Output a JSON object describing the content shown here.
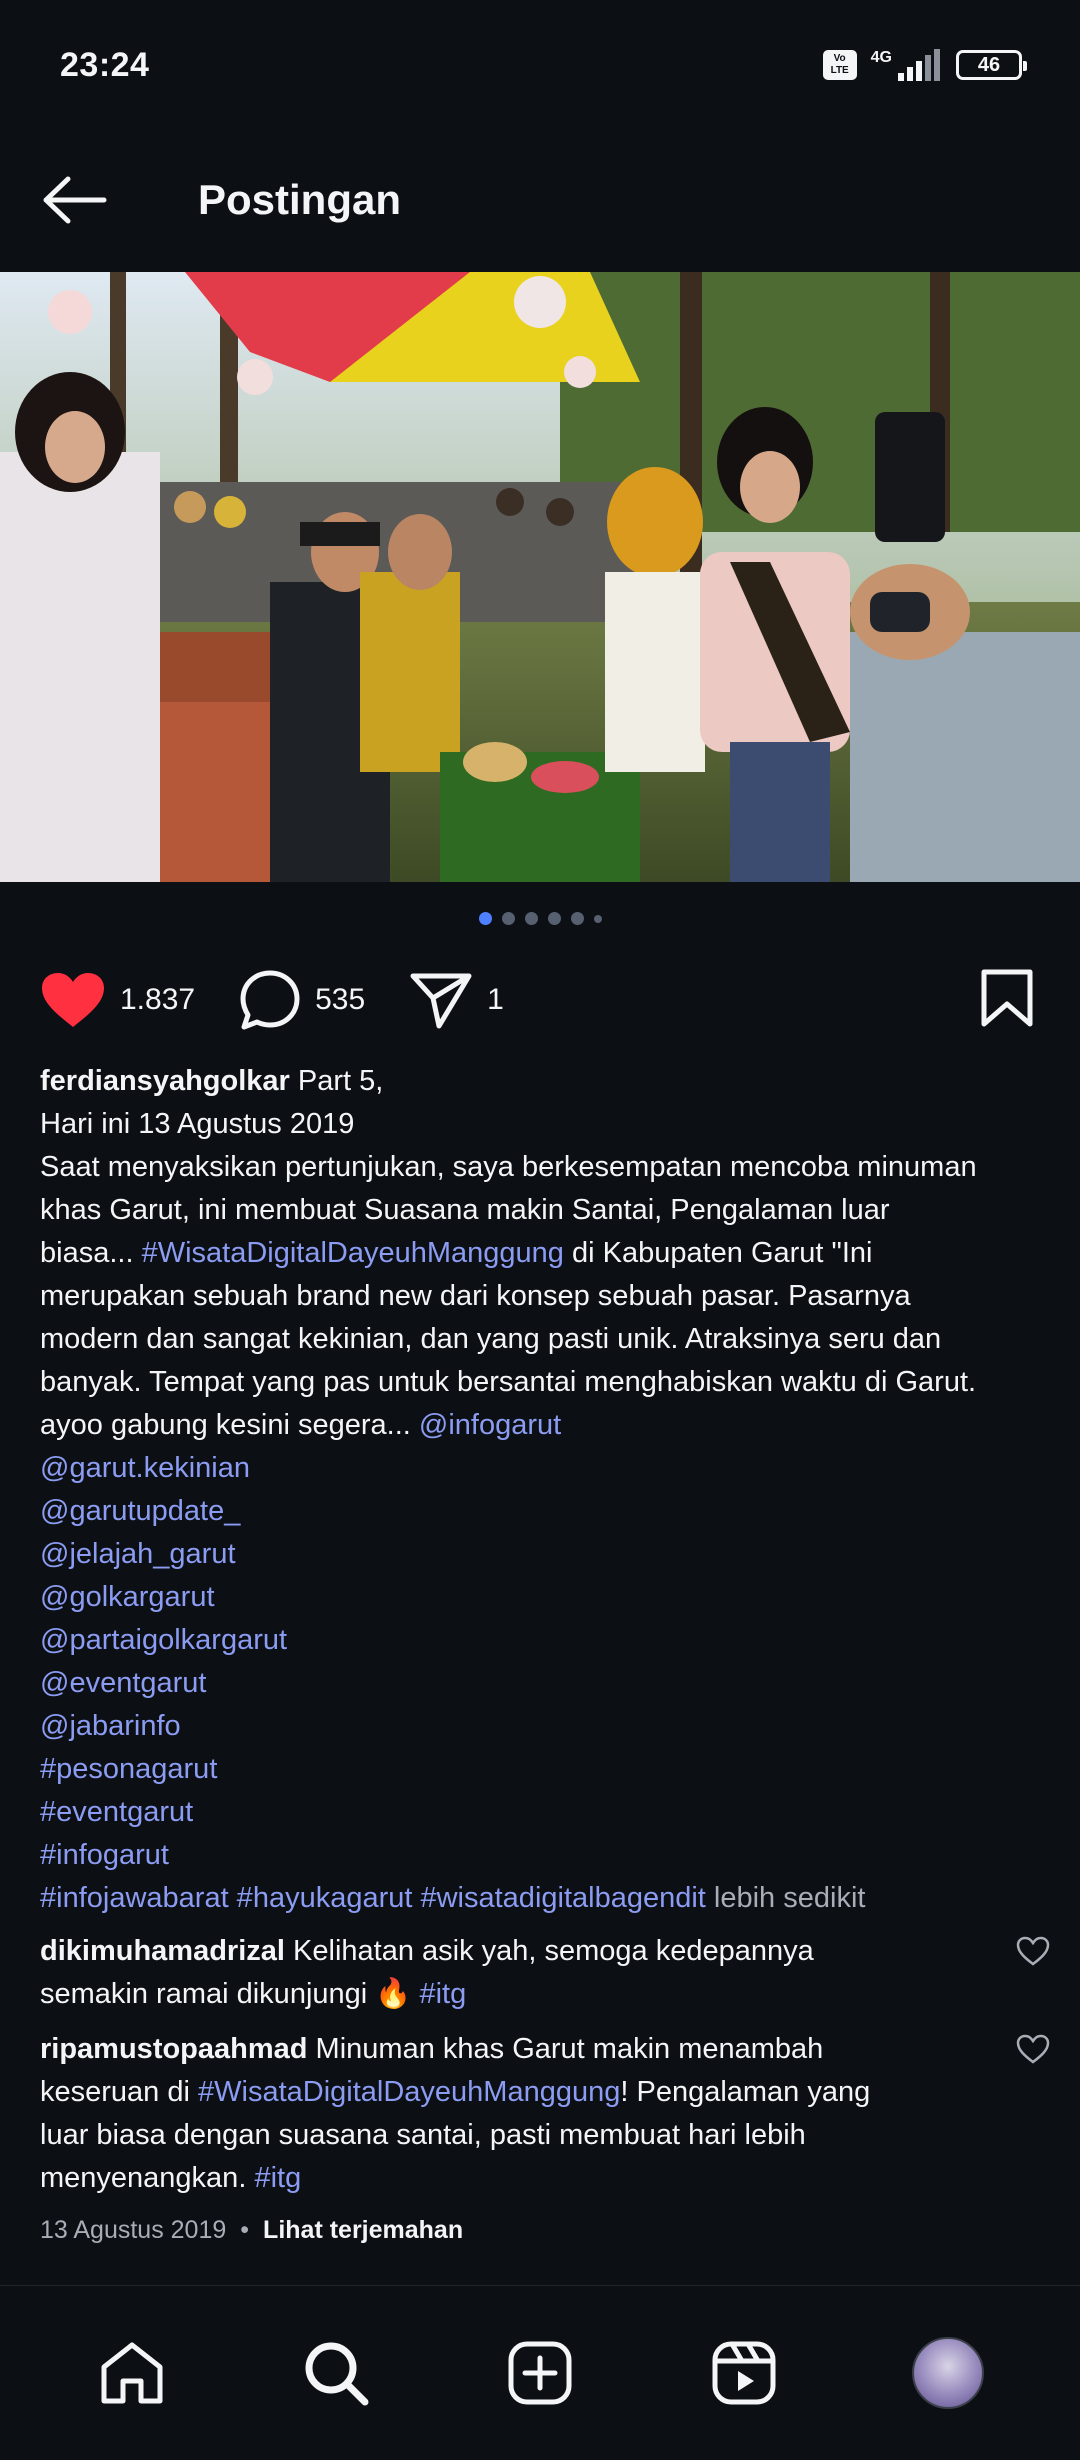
{
  "status": {
    "time": "23:24",
    "network": "4G",
    "battery": "46",
    "volte_top": "Vo",
    "volte_bottom": "LTE"
  },
  "header": {
    "title": "Postingan"
  },
  "post": {
    "carousel": {
      "count": 6,
      "active": 0
    },
    "likes": "1.837",
    "comments": "535",
    "shares": "1",
    "caption": {
      "username": "ferdiansyahgolkar",
      "line1_rest": " Part 5,",
      "line2": "Hari ini 13 Agustus 2019",
      "line3": "Saat menyaksikan pertunjukan, saya berkesempatan mencoba minuman",
      "line4": "khas Garut, ini membuat Suasana makin Santai, Pengalaman luar",
      "line5_a": "biasa... ",
      "line5_link": "#WisataDigitalDayeuhManggung",
      "line5_b": " di Kabupaten Garut \"Ini",
      "line6": "merupakan sebuah brand new dari konsep sebuah pasar. Pasarnya",
      "line7": "modern dan sangat kekinian, dan yang pasti unik. Atraksinya seru dan",
      "line8": "banyak. Tempat yang pas untuk bersantai menghabiskan waktu di Garut.",
      "line9_a": "ayoo gabung kesini segera... ",
      "line9_link": "@infogarut",
      "tags": [
        "@garut.kekinian",
        "@garutupdate_",
        "@jelajah_garut",
        "@golkargarut",
        "@partaigolkargarut",
        "@eventgarut",
        "@jabarinfo",
        "#pesonagarut",
        "#eventgarut",
        "#infogarut"
      ],
      "last_tags": "#infojawabarat #hayukagarut #wisatadigitalbagendit",
      "less": " lebih sedikit"
    },
    "comment_list": [
      {
        "user": "dikimuhamadrizal",
        "text1": " Kelihatan asik yah, semoga kedepannya",
        "text2": "semakin ramai dikunjungi 🔥 ",
        "tag": "#itg"
      },
      {
        "user": "ripamustopaahmad",
        "text1": " Minuman khas Garut makin menambah",
        "text2_a": "keseruan di ",
        "text2_link": "#WisataDigitalDayeuhManggung",
        "text2_b": "! Pengalaman yang",
        "text3": "luar biasa dengan suasana santai, pasti membuat hari lebih",
        "text4": "menyenangkan. ",
        "tag": "#itg"
      }
    ],
    "date": "13 Agustus 2019",
    "separator": "•",
    "translate": "Lihat terjemahan"
  },
  "nav": {
    "items": [
      "home-icon",
      "search-icon",
      "create-icon",
      "reels-icon",
      "profile-avatar"
    ]
  },
  "colors": {
    "background": "#0c0f14",
    "link": "#8b9cf2",
    "like": "#ff3040",
    "dot_active": "#4f80ff"
  }
}
